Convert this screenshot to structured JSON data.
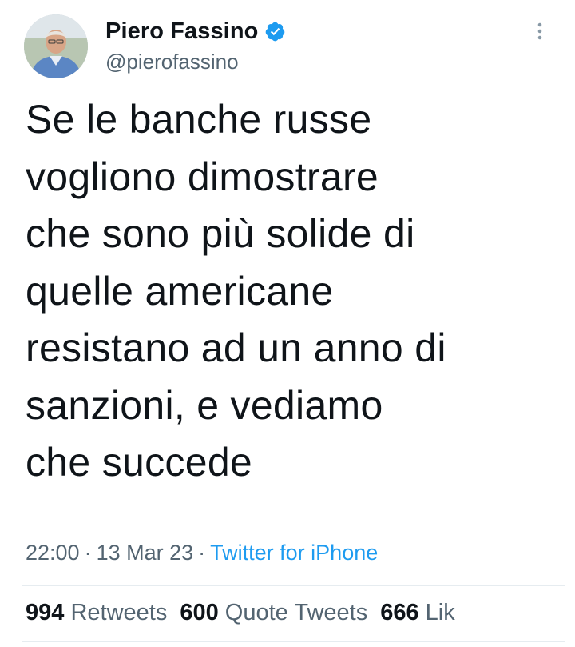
{
  "author": {
    "display_name": "Piero Fassino",
    "handle": "@pierofassino",
    "verified": true
  },
  "tweet": {
    "text": "Se le banche russe\nvogliono dimostrare\nche sono più solide di\nquelle americane\nresistano ad un anno di\nsanzioni, e vediamo\nche succede"
  },
  "meta": {
    "time": "22:00",
    "date": "13 Mar 23",
    "separator": "·",
    "source": "Twitter for iPhone"
  },
  "stats": {
    "retweets_count": "994",
    "retweets_label": "Retweets",
    "quotes_count": "600",
    "quotes_label": "Quote Tweets",
    "likes_count": "666",
    "likes_label": "Lik"
  },
  "colors": {
    "accent": "#1d9bf0",
    "text": "#0f1419",
    "secondary": "#536471"
  },
  "icons": {
    "verified": "verified-badge-icon",
    "more": "more-vertical-icon"
  }
}
